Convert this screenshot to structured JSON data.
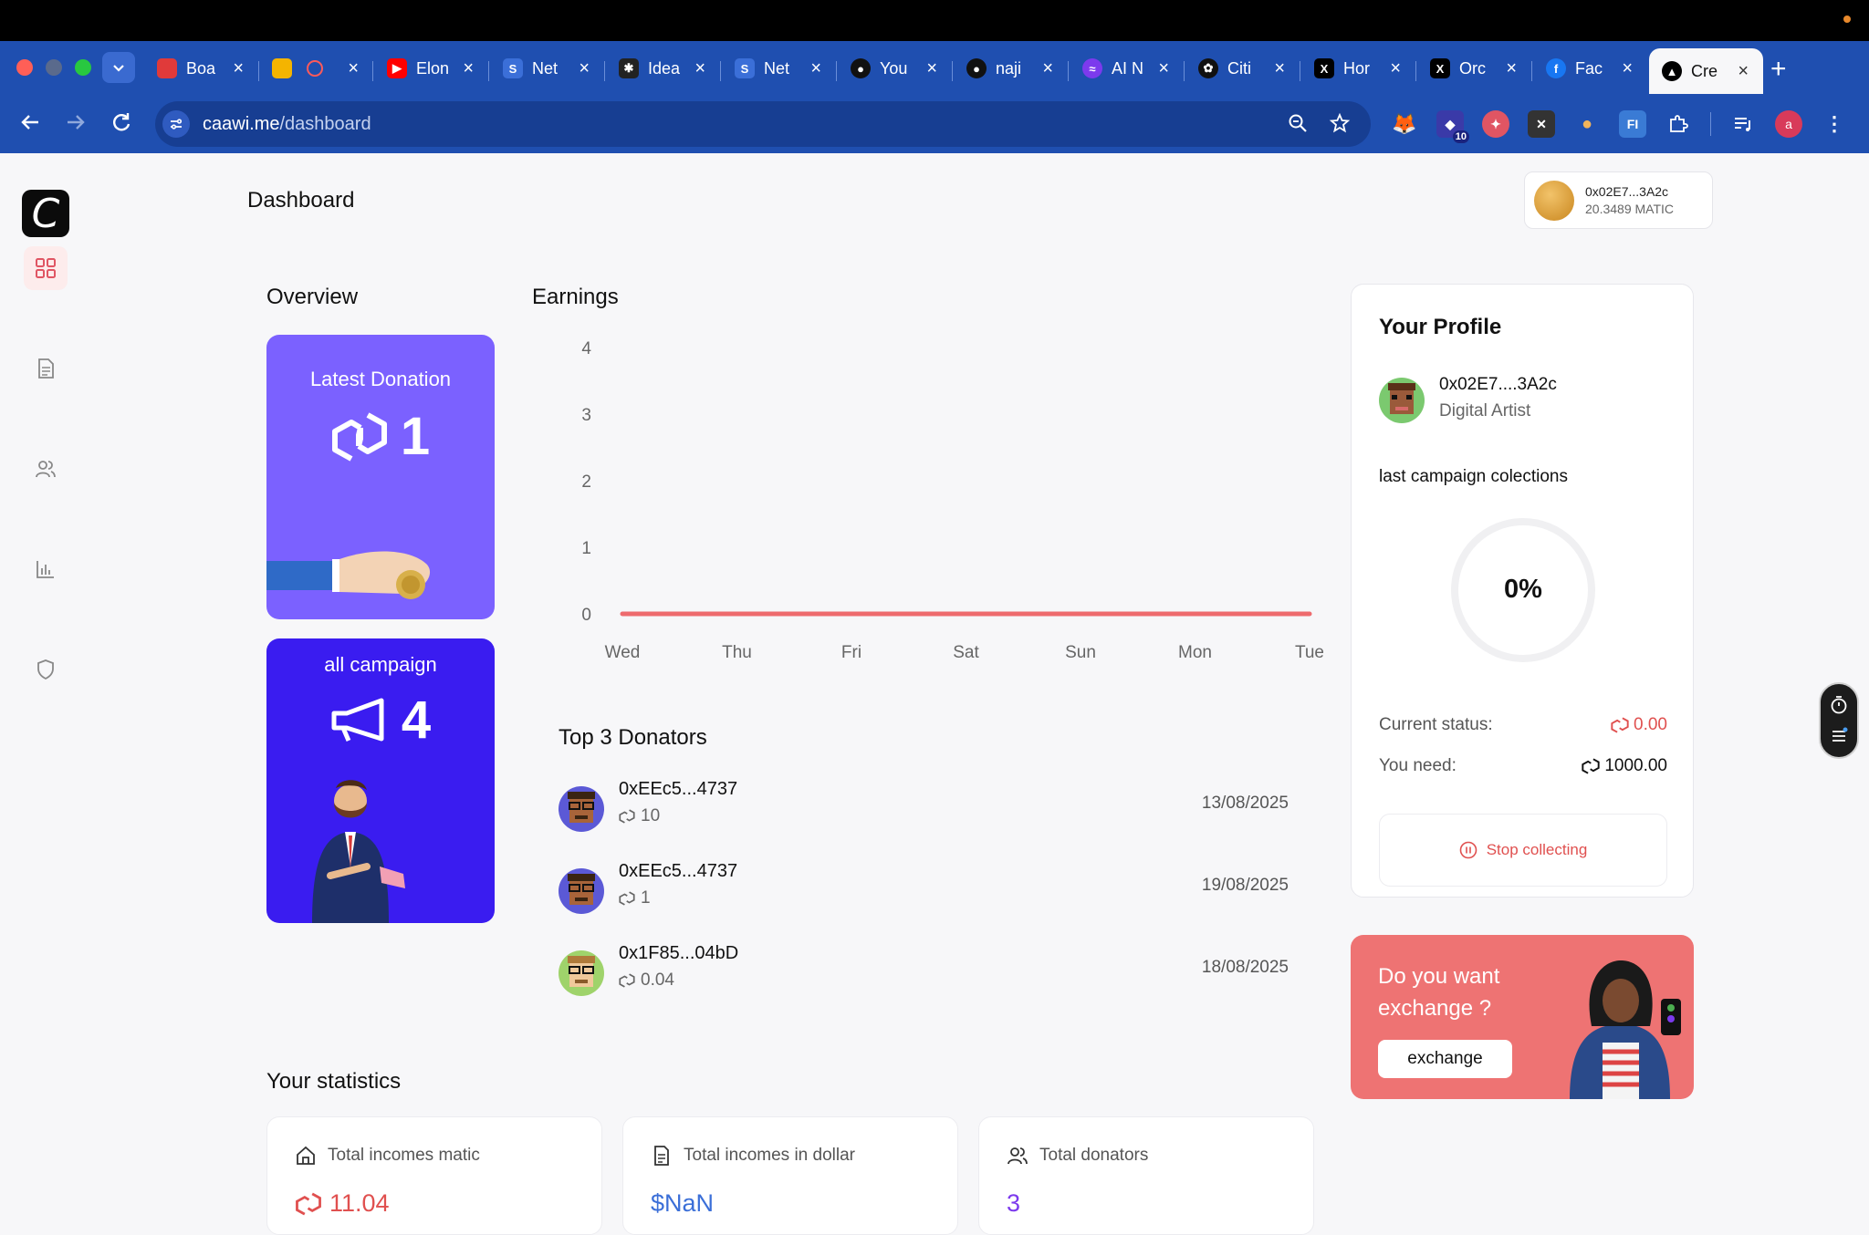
{
  "browser": {
    "tabs": [
      {
        "title": "Boa",
        "color": "#e03a3a"
      },
      {
        "title": "",
        "color": "#f4b400"
      },
      {
        "title": "Elon",
        "color": "#ff0000"
      },
      {
        "title": "Net",
        "color": "#3b6fd8"
      },
      {
        "title": "Idea",
        "color": "#222222"
      },
      {
        "title": "Net",
        "color": "#3b6fd8"
      },
      {
        "title": "You",
        "color": "#111111"
      },
      {
        "title": "naji",
        "color": "#111111"
      },
      {
        "title": "AI N",
        "color": "#7c3aed"
      },
      {
        "title": "Citi",
        "color": "#111111"
      },
      {
        "title": "Hor",
        "color": "#000000"
      },
      {
        "title": "Orc",
        "color": "#000000"
      },
      {
        "title": "Fac",
        "color": "#1877f2"
      },
      {
        "title": "Cre",
        "color": "#000000"
      }
    ],
    "url_host": "caawi.me",
    "url_path": "/dashboard",
    "extensions": {
      "badge": "10",
      "fi_label": "FI",
      "profile_initial": "a"
    }
  },
  "sidebar": {
    "logo": "C",
    "items": [
      "dashboard-icon",
      "document-icon",
      "users-icon",
      "chart-icon",
      "shield-icon"
    ]
  },
  "header": {
    "title": "Dashboard",
    "wallet": {
      "address": "0x02E7...3A2c",
      "balance": "20.3489 MATIC"
    }
  },
  "overview": {
    "title": "Overview",
    "latest": {
      "label": "Latest Donation",
      "value": "1"
    },
    "campaign": {
      "label": "all campaign",
      "value": "4"
    }
  },
  "earnings": {
    "title": "Earnings"
  },
  "chart_data": {
    "type": "line",
    "title": "Earnings",
    "categories": [
      "Wed",
      "Thu",
      "Fri",
      "Sat",
      "Sun",
      "Mon",
      "Tue"
    ],
    "y_ticks": [
      "4",
      "3",
      "2",
      "1",
      "0"
    ],
    "ylim": [
      0,
      4
    ],
    "series": [
      {
        "values": [
          0,
          0,
          0,
          0,
          0,
          0,
          0
        ],
        "color": "#ee6b6e"
      }
    ],
    "grid": false
  },
  "donators": {
    "title": "Top 3 Donators",
    "items": [
      {
        "address": "0xEEc5...4737",
        "amount": "10",
        "date": "13/08/2025"
      },
      {
        "address": "0xEEc5...4737",
        "amount": "1",
        "date": "19/08/2025"
      },
      {
        "address": "0x1F85...04bD",
        "amount": "0.04",
        "date": "18/08/2025"
      }
    ]
  },
  "profile": {
    "title": "Your Profile",
    "address": "0x02E7....3A2c",
    "role": "Digital Artist",
    "subtitle": "last campaign colections",
    "progress_percent": "0%",
    "status_label": "Current status:",
    "status_value": "0.00",
    "need_label": "You need:",
    "need_value": "1000.00",
    "stop_label": "Stop collecting"
  },
  "exchange": {
    "text": "Do you want exchange ?",
    "button": "exchange"
  },
  "statistics": {
    "title": "Your statistics",
    "cards": [
      {
        "label": "Total incomes matic",
        "value": "11.04",
        "color": "#e0504f"
      },
      {
        "label": "Total incomes in dollar",
        "value": "$NaN",
        "color": "#3b6fd8"
      },
      {
        "label": "Total donators",
        "value": "3",
        "color": "#7c3aed"
      }
    ]
  },
  "colors": {
    "accent": "#ee6b6e",
    "purple": "#7b61ff",
    "indigo": "#3a1cf0",
    "brand_blue": "#1f4fb0"
  }
}
